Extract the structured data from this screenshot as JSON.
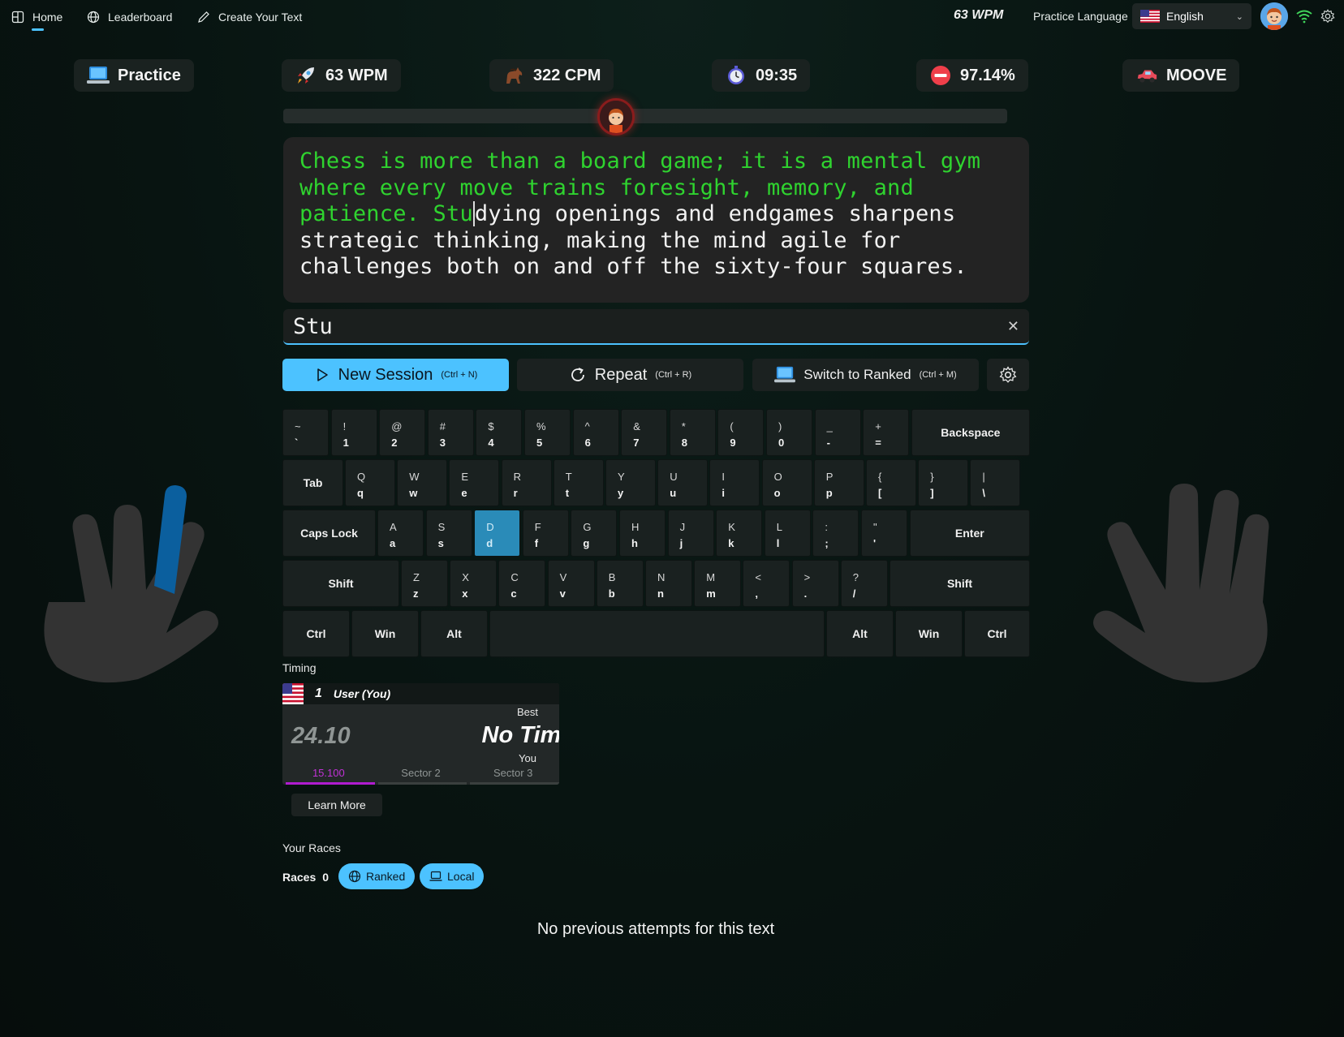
{
  "nav": {
    "home": "Home",
    "leaderboard": "Leaderboard",
    "create_text": "Create Your Text",
    "top_wpm": "63 WPM",
    "practice_language_label": "Practice Language",
    "language": "English"
  },
  "stats": {
    "mode": "Practice",
    "wpm": "63 WPM",
    "cpm": "322 CPM",
    "time": "09:35",
    "accuracy": "97.14%",
    "vehicle": "MOOVE"
  },
  "progress": {
    "fraction": 0.42
  },
  "passage": {
    "typed": "Chess is more than a board game; it is a mental gym where every move trains foresight, memory, and patience. Stu",
    "remaining": "dying openings and endgames sharpens strategic thinking, making the mind agile for challenges both on and off the sixty-four squares."
  },
  "input": {
    "value": "Stu",
    "clear_icon": "close-icon"
  },
  "actions": {
    "new_session": "New Session",
    "new_session_kbd": "(Ctrl + N)",
    "repeat": "Repeat",
    "repeat_kbd": "(Ctrl + R)",
    "switch_ranked": "Switch to Ranked",
    "switch_ranked_kbd": "(Ctrl + M)"
  },
  "keyboard": {
    "row1": [
      {
        "s": "~",
        "b": "`"
      },
      {
        "s": "!",
        "b": "1"
      },
      {
        "s": "@",
        "b": "2"
      },
      {
        "s": "#",
        "b": "3"
      },
      {
        "s": "$",
        "b": "4"
      },
      {
        "s": "%",
        "b": "5"
      },
      {
        "s": "^",
        "b": "6"
      },
      {
        "s": "&",
        "b": "7"
      },
      {
        "s": "*",
        "b": "8"
      },
      {
        "s": "(",
        "b": "9"
      },
      {
        "s": ")",
        "b": "0"
      },
      {
        "s": "_",
        "b": "-"
      },
      {
        "s": "+",
        "b": "="
      }
    ],
    "backspace": "Backspace",
    "tab": "Tab",
    "row2": [
      {
        "s": "Q",
        "b": "q"
      },
      {
        "s": "W",
        "b": "w"
      },
      {
        "s": "E",
        "b": "e"
      },
      {
        "s": "R",
        "b": "r"
      },
      {
        "s": "T",
        "b": "t"
      },
      {
        "s": "Y",
        "b": "y"
      },
      {
        "s": "U",
        "b": "u"
      },
      {
        "s": "I",
        "b": "i"
      },
      {
        "s": "O",
        "b": "o"
      },
      {
        "s": "P",
        "b": "p"
      },
      {
        "s": "{",
        "b": "["
      },
      {
        "s": "}",
        "b": "]"
      },
      {
        "s": "|",
        "b": "\\"
      }
    ],
    "caps": "Caps Lock",
    "row3": [
      {
        "s": "A",
        "b": "a"
      },
      {
        "s": "S",
        "b": "s"
      },
      {
        "s": "D",
        "b": "d"
      },
      {
        "s": "F",
        "b": "f"
      },
      {
        "s": "G",
        "b": "g"
      },
      {
        "s": "H",
        "b": "h"
      },
      {
        "s": "J",
        "b": "j"
      },
      {
        "s": "K",
        "b": "k"
      },
      {
        "s": "L",
        "b": "l"
      },
      {
        "s": ":",
        "b": ";"
      },
      {
        "s": "\"",
        "b": "'"
      }
    ],
    "enter": "Enter",
    "shift": "Shift",
    "row4": [
      {
        "s": "Z",
        "b": "z"
      },
      {
        "s": "X",
        "b": "x"
      },
      {
        "s": "C",
        "b": "c"
      },
      {
        "s": "V",
        "b": "v"
      },
      {
        "s": "B",
        "b": "b"
      },
      {
        "s": "N",
        "b": "n"
      },
      {
        "s": "M",
        "b": "m"
      },
      {
        "s": "<",
        "b": ","
      },
      {
        "s": ">",
        "b": "."
      },
      {
        "s": "?",
        "b": "/"
      }
    ],
    "ctrl": "Ctrl",
    "win": "Win",
    "alt": "Alt",
    "active_key": "d"
  },
  "timing": {
    "label": "Timing",
    "rank": "1",
    "user": "User (You)",
    "time": "24.10",
    "best_label": "Best",
    "best_value": "No Time",
    "you_label": "You",
    "sector1": "15.100",
    "sector2": "Sector 2",
    "sector3": "Sector 3",
    "learn_more": "Learn More"
  },
  "races": {
    "label": "Your Races",
    "count_label": "Races",
    "count": "0",
    "ranked": "Ranked",
    "local": "Local",
    "empty": "No previous attempts for this text"
  },
  "colors": {
    "accent": "#4cc2ff",
    "typed": "#2fd32f",
    "active_finger": "#0b5f9e",
    "sector_best": "#b01cd0"
  }
}
